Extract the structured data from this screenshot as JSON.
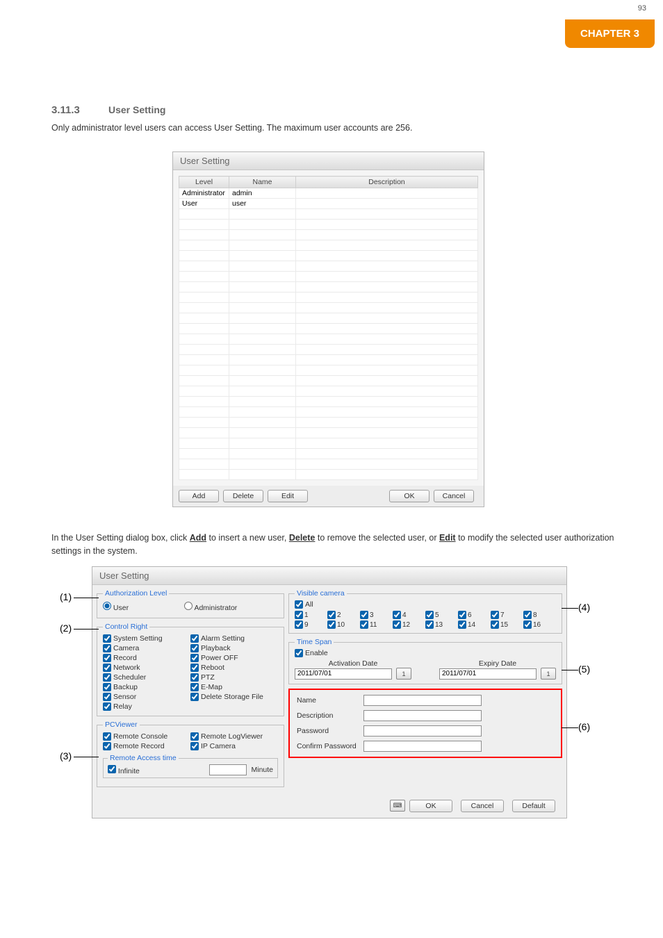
{
  "chapter_label": "CHAPTER 3",
  "page_number": "93",
  "section_number": "3.11.3",
  "section_title": "User Setting",
  "intro_text": "Only administrator level users can access User Setting. The maximum user accounts are 256.",
  "shot1": {
    "title": "User Setting",
    "headers": [
      "Level",
      "Name",
      "Description"
    ],
    "rows": [
      {
        "level": "Administrator",
        "name": "admin",
        "desc": ""
      },
      {
        "level": "User",
        "name": "user",
        "desc": ""
      }
    ],
    "empty_rows": 26,
    "btn_add": "Add",
    "btn_delete": "Delete",
    "btn_edit": "Edit",
    "btn_ok": "OK",
    "btn_cancel": "Cancel"
  },
  "para2_prefix": "In the User Setting dialog box, click ",
  "para2_add": "Add",
  "para2_mid": " to insert a new user, ",
  "para2_delete": "Delete",
  "para2_mid2": " to remove the selected user, or ",
  "para2_edit": "Edit",
  "para2_end": " to modify the selected user authorization settings in the system.",
  "shot2": {
    "title": "User Setting",
    "auth_level": {
      "legend": "Authorization Level",
      "user": "User",
      "admin": "Administrator"
    },
    "control": {
      "legend": "Control Right",
      "items": [
        [
          "System Setting",
          "Alarm Setting"
        ],
        [
          "Camera",
          "Playback"
        ],
        [
          "Record",
          "Power OFF"
        ],
        [
          "Network",
          "Reboot"
        ],
        [
          "Scheduler",
          "PTZ"
        ],
        [
          "Backup",
          "E-Map"
        ],
        [
          "Sensor",
          "Delete Storage File"
        ],
        [
          "Relay",
          ""
        ]
      ]
    },
    "pcviewer": {
      "legend": "PCViewer",
      "items": [
        [
          "Remote Console",
          "Remote LogViewer"
        ],
        [
          "Remote Record",
          "IP Camera"
        ]
      ],
      "rat_legend": "Remote Access time",
      "infinite": "Infinite",
      "minute": "Minute"
    },
    "visible": {
      "legend": "Visible camera",
      "all": "All",
      "cams": [
        "1",
        "2",
        "3",
        "4",
        "5",
        "6",
        "7",
        "8",
        "9",
        "10",
        "11",
        "12",
        "13",
        "14",
        "15",
        "16"
      ]
    },
    "timespan": {
      "legend": "Time Span",
      "enable": "Enable",
      "act_label": "Activation Date",
      "exp_label": "Expiry Date",
      "act_val": "2011/07/01",
      "exp_val": "2011/07/01"
    },
    "fields": {
      "name": "Name",
      "desc": "Description",
      "pw": "Password",
      "cpw": "Confirm Password"
    },
    "btn_ok": "OK",
    "btn_cancel": "Cancel",
    "btn_default": "Default"
  },
  "callouts": {
    "c1": "(1)",
    "c2": "(2)",
    "c3": "(3)",
    "c4": "(4)",
    "c5": "(5)",
    "c6": "(6)"
  }
}
